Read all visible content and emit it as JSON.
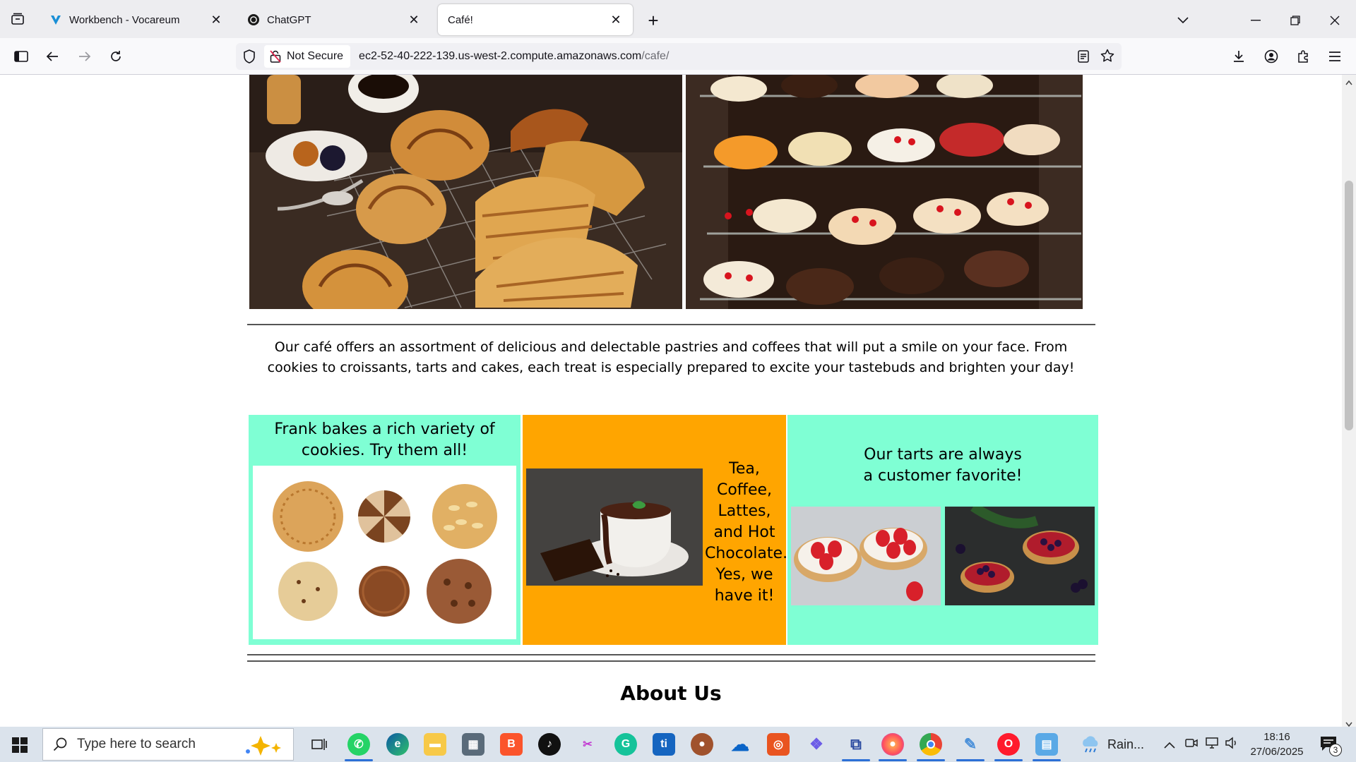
{
  "browser": {
    "tabs": [
      {
        "title": "Workbench - Vocareum",
        "icon": "vocareum-logo-icon"
      },
      {
        "title": "ChatGPT",
        "icon": "chatgpt-logo-icon"
      },
      {
        "title": "Café!",
        "icon": "none"
      }
    ],
    "security_label": "Not Secure",
    "url_host": "ec2-52-40-222-139.us-west-2.compute.amazonaws.com",
    "url_path": "/cafe/"
  },
  "page": {
    "intro_text": "Our café offers an assortment of delicious and delectable pastries and coffees that will put a smile on your face. From cookies to croissants, tarts and cakes, each treat is especially prepared to excite your tastebuds and brighten your day!",
    "cookies_caption": "Frank bakes a rich variety of cookies. Try them all!",
    "drinks_caption": "Tea, Coffee, Lattes, and Hot Chocolate. Yes, we have it!",
    "tarts_caption": "Our tarts are always a customer favorite!",
    "about_heading": "About Us",
    "colors": {
      "aqua_panel": "#7fffd4",
      "orange_panel": "#ffa500"
    }
  },
  "taskbar": {
    "search_placeholder": "Type here to search",
    "weather": "Rain...",
    "time": "18:16",
    "date": "27/06/2025",
    "notification_count": "3",
    "apps": [
      "task-view-icon",
      "whatsapp-icon",
      "edge-icon",
      "file-explorer-icon",
      "calculator-icon",
      "brave-icon",
      "tiktok-icon",
      "snipping-tool-icon",
      "grammarly-icon",
      "ti-app-icon",
      "app-circle-icon",
      "onedrive-icon",
      "ubuntu-icon",
      "sparkle-app-icon",
      "network-app-icon",
      "firefox-icon",
      "chrome-icon",
      "paint-icon",
      "opera-icon",
      "notepad-icon"
    ]
  }
}
